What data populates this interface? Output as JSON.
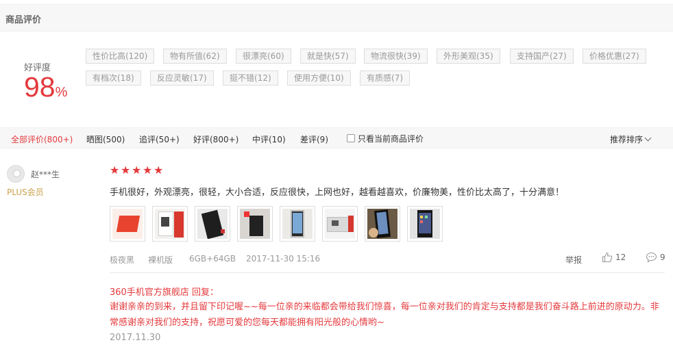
{
  "header": {
    "title": "商品评价"
  },
  "rating": {
    "label": "好评度",
    "value": "98",
    "unit": "%"
  },
  "tags": [
    "性价比高(120)",
    "物有所值(62)",
    "很漂亮(60)",
    "就是快(57)",
    "物流很快(39)",
    "外形美观(35)",
    "支持国产(27)",
    "价格优惠(27)",
    "有档次(18)",
    "反应灵敏(17)",
    "挺不错(12)",
    "使用方便(10)",
    "有质感(7)"
  ],
  "filters": {
    "items": [
      "全部评价(800+)",
      "晒图(500)",
      "追评(50+)",
      "好评(800+)",
      "中评(10)",
      "差评(9)"
    ],
    "only_current": "只看当前商品评价",
    "sort": "推荐排序"
  },
  "review": {
    "user": "赵***生",
    "member": "PLUS会员",
    "stars": 5,
    "text": "手机很好，外观漂亮，很轻，大小合适，反应很快，上网也好，越看越喜欢，价廉物美，性价比太高了，十分满意！",
    "meta": {
      "color": "极夜黑",
      "package": "裸机版",
      "spec": "6GB+64GB",
      "time": "2017-11-30 15:16"
    },
    "report": "举报",
    "likes": "12",
    "replies": "9",
    "images": [
      "phone-box-red",
      "phone-box-open",
      "phone-back",
      "phone-accessories",
      "phone-screen",
      "phone-box-side",
      "phone-in-hand",
      "phone-home-screen"
    ]
  },
  "reply": {
    "head": "360手机官方旗舰店 回复：",
    "body": "谢谢亲亲的到来，并且留下印记喔~~每一位亲的来临都会带给我们惊喜，每一位亲对我们的肯定与支持都是我们奋斗路上前进的原动力。非常感谢亲对我们的支持，祝愿可爱的您每天都能拥有阳光般的心情哟~",
    "date": "2017.11.30"
  },
  "colors": {
    "accent": "#e4393c",
    "plus": "#c8a24a"
  }
}
